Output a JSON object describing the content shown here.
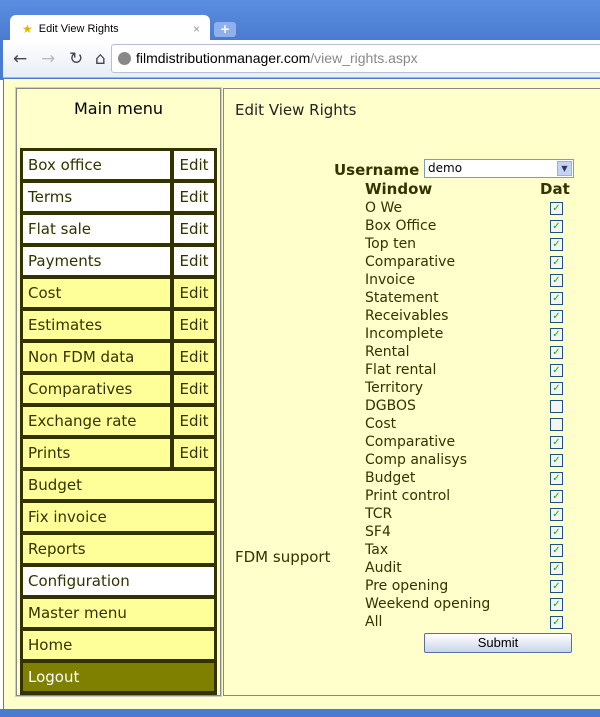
{
  "browser": {
    "tab_title": "Edit View Rights",
    "url_host": "filmdistributionmanager.com",
    "url_path": "/view_rights.aspx"
  },
  "menu": {
    "title": "Main menu",
    "items": [
      {
        "label": "Box office",
        "edit": "Edit",
        "style": "w"
      },
      {
        "label": "Terms",
        "edit": "Edit",
        "style": "w"
      },
      {
        "label": "Flat sale",
        "edit": "Edit",
        "style": "w"
      },
      {
        "label": "Payments",
        "edit": "Edit",
        "style": "w"
      },
      {
        "label": "Cost",
        "edit": "Edit",
        "style": "y"
      },
      {
        "label": "Estimates",
        "edit": "Edit",
        "style": "y"
      },
      {
        "label": "Non FDM data",
        "edit": "Edit",
        "style": "y"
      },
      {
        "label": "Comparatives",
        "edit": "Edit",
        "style": "y"
      },
      {
        "label": "Exchange rate",
        "edit": "Edit",
        "style": "y"
      },
      {
        "label": "Prints",
        "edit": "Edit",
        "style": "y"
      },
      {
        "label": "Budget",
        "style": "y"
      },
      {
        "label": "Fix invoice",
        "style": "y"
      },
      {
        "label": "Reports",
        "style": "y"
      },
      {
        "label": "Configuration",
        "style": "w"
      },
      {
        "label": "Master menu",
        "style": "y"
      },
      {
        "label": "Home",
        "style": "y"
      },
      {
        "label": "Logout",
        "style": "o"
      }
    ]
  },
  "main": {
    "title": "Edit View Rights",
    "username_label": "Username",
    "username_value": "demo",
    "col_window": "Window",
    "col_dat": "Dat",
    "group_label": "FDM support",
    "submit": "Submit",
    "rights": [
      {
        "name": "O We",
        "checked": true
      },
      {
        "name": "Box Office",
        "checked": true
      },
      {
        "name": "Top ten",
        "checked": true
      },
      {
        "name": "Comparative",
        "checked": true
      },
      {
        "name": "Invoice",
        "checked": true
      },
      {
        "name": "Statement",
        "checked": true
      },
      {
        "name": "Receivables",
        "checked": true
      },
      {
        "name": "Incomplete",
        "checked": true
      },
      {
        "name": "Rental",
        "checked": true
      },
      {
        "name": "Flat rental",
        "checked": true
      },
      {
        "name": "Territory",
        "checked": true
      },
      {
        "name": "DGBOS",
        "checked": false
      },
      {
        "name": "Cost",
        "checked": false
      },
      {
        "name": "Comparative",
        "checked": true
      },
      {
        "name": "Comp analisys",
        "checked": true
      },
      {
        "name": "Budget",
        "checked": true
      },
      {
        "name": "Print control",
        "checked": true
      },
      {
        "name": "TCR",
        "checked": true
      },
      {
        "name": "SF4",
        "checked": true
      },
      {
        "name": "Tax",
        "checked": true
      },
      {
        "name": "Audit",
        "checked": true
      },
      {
        "name": "Pre opening",
        "checked": true
      },
      {
        "name": "Weekend opening",
        "checked": true
      },
      {
        "name": "All",
        "checked": true
      }
    ]
  }
}
